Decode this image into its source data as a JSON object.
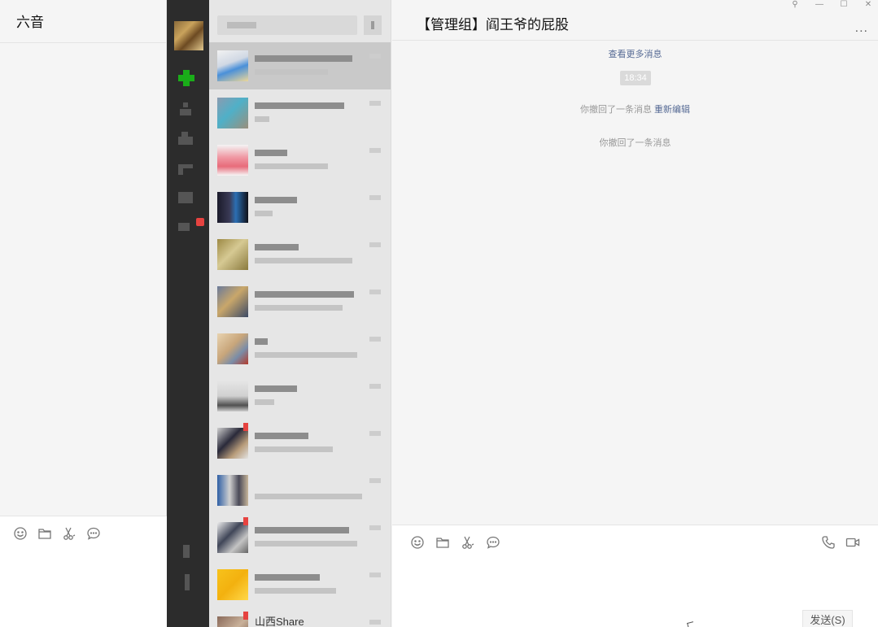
{
  "left_chat": {
    "title": "六音"
  },
  "chat_list": {
    "last_item_label": "山西Share"
  },
  "main": {
    "title": "【管理组】阎王爷的屁股",
    "more": "...",
    "load_more": "查看更多消息",
    "time": "18:34",
    "recall_notice": "你撤回了一条消息",
    "reedit": "重新编辑",
    "recall_notice_2": "你撤回了一条消息",
    "send_label": "发送(S)"
  },
  "window_controls": {
    "pin": "⚲",
    "minimize": "—",
    "maximize": "☐",
    "close": "✕"
  },
  "colors": {
    "nav_bg": "#2c2c2c",
    "list_bg": "#e6e6e6",
    "active_item": "#c9c9c9",
    "accent_green": "#1aad19",
    "badge_red": "#e64340",
    "link_blue": "#576b95"
  },
  "icons": [
    "emoji-icon",
    "folder-icon",
    "scissors-icon",
    "chat-bubble-icon",
    "phone-icon",
    "video-icon"
  ]
}
